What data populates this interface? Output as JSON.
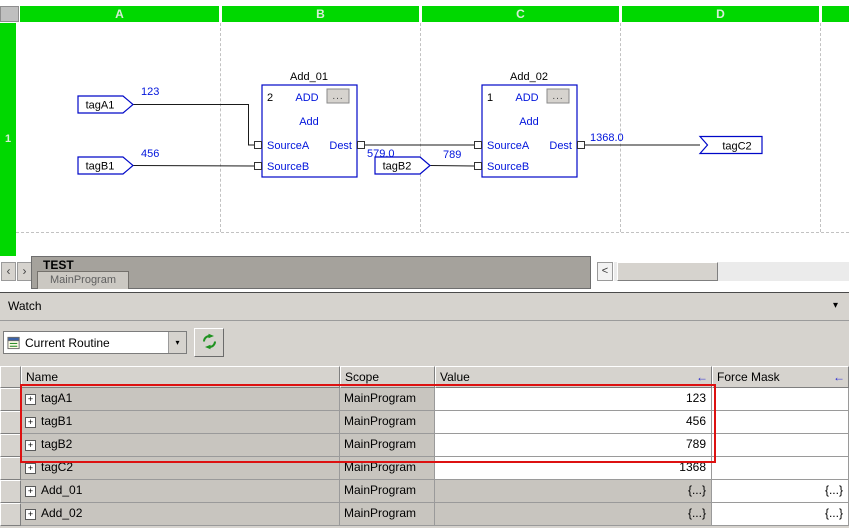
{
  "fbd": {
    "columns": [
      "A",
      "B",
      "C",
      "D"
    ],
    "row_label": "1",
    "tagA1": "tagA1",
    "tagA1_value": "123",
    "tagB1": "tagB1",
    "tagB1_value": "456",
    "tagB2": "tagB2",
    "tagB2_value": "789",
    "tagC2": "tagC2",
    "add01": {
      "title": "Add_01",
      "order": "2",
      "opcode": "ADD",
      "ellipsis": "...",
      "name": "Add",
      "source_a": "SourceA",
      "source_b": "SourceB",
      "dest": "Dest",
      "out_value": "579.0"
    },
    "add02": {
      "title": "Add_02",
      "order": "1",
      "opcode": "ADD",
      "ellipsis": "...",
      "name": "Add",
      "source_a": "SourceA",
      "source_b": "SourceB",
      "dest": "Dest",
      "out_value": "1368.0"
    }
  },
  "tabstrip": {
    "back": "‹",
    "forward": "›",
    "window_title": "TEST",
    "tab": "MainProgram",
    "scroll_left": "<"
  },
  "watch": {
    "title": "Watch",
    "collapse_icon": "▾",
    "combo_value": "Current Routine",
    "combo_arrow": "▾",
    "headers": {
      "name": "Name",
      "scope": "Scope",
      "value": "Value",
      "force": "Force Mask",
      "sort_arrow": "←"
    },
    "rows": [
      {
        "expand": "+",
        "name": "tagA1",
        "scope": "MainProgram",
        "value": "123",
        "force": ""
      },
      {
        "expand": "+",
        "name": "tagB1",
        "scope": "MainProgram",
        "value": "456",
        "force": ""
      },
      {
        "expand": "+",
        "name": "tagB2",
        "scope": "MainProgram",
        "value": "789",
        "force": ""
      },
      {
        "expand": "+",
        "name": "tagC2",
        "scope": "MainProgram",
        "value": "1368",
        "force": ""
      },
      {
        "expand": "+",
        "name": "Add_01",
        "scope": "MainProgram",
        "value": "{...}",
        "force": "{...}"
      },
      {
        "expand": "+",
        "name": "Add_02",
        "scope": "MainProgram",
        "value": "{...}",
        "force": "{...}"
      }
    ]
  }
}
